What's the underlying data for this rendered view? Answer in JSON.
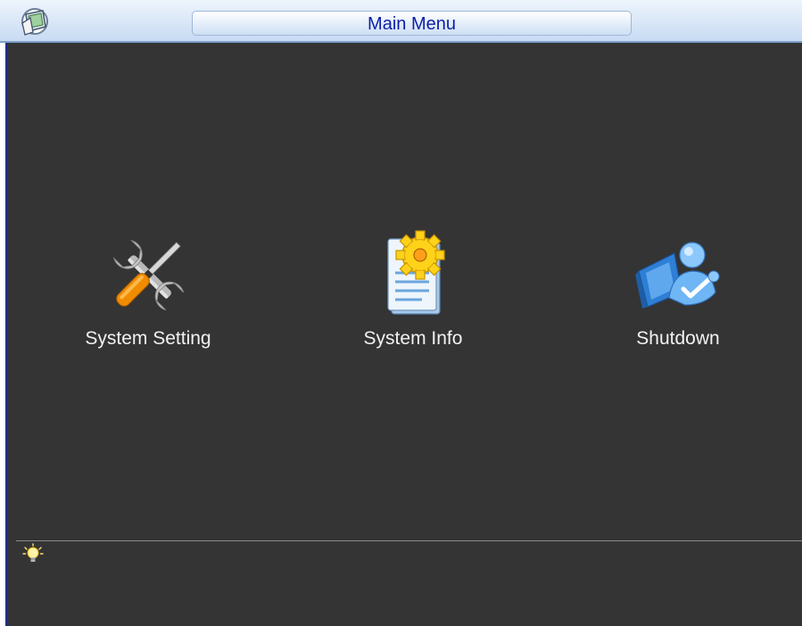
{
  "window": {
    "title": "Main Menu",
    "logo_icon": "dvr-logo-icon"
  },
  "menu": {
    "items": [
      {
        "label": "System Setting",
        "icon": "wrench-screwdriver-icon"
      },
      {
        "label": "System Info",
        "icon": "document-gear-icon"
      },
      {
        "label": "Shutdown",
        "icon": "user-logout-icon"
      }
    ]
  },
  "status_bar": {
    "hint_icon": "lightbulb-icon",
    "hint_text": ""
  },
  "colors": {
    "panel_background": "#343434",
    "title_text": "#0b1ea8",
    "label_text": "#f2f2f2",
    "accent_orange": "#f08c00",
    "accent_yellow": "#ffd21a",
    "accent_blue": "#2f7fd6"
  }
}
